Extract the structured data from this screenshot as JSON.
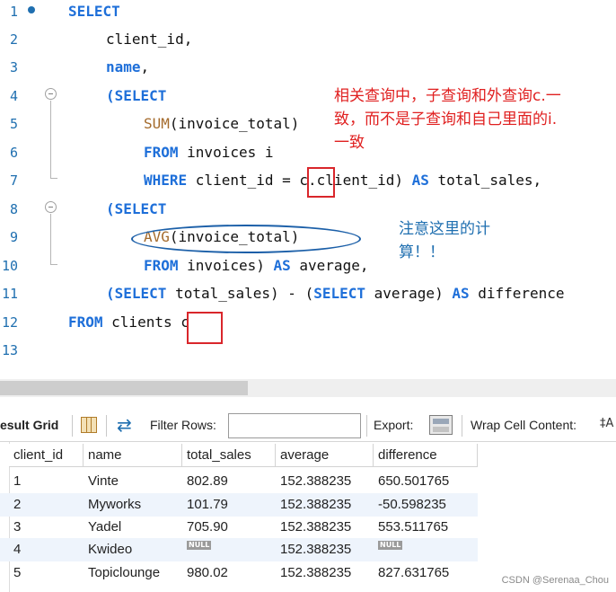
{
  "editor": {
    "line_numbers": [
      "1",
      "2",
      "3",
      "4",
      "5",
      "6",
      "7",
      "8",
      "9",
      "10",
      "11",
      "12",
      "13"
    ],
    "code": {
      "l1_kw": "SELECT",
      "l2": "client_id,",
      "l3_kw": "name",
      "l3_tail": ",",
      "l4_open": "(",
      "l4_kw": "SELECT",
      "l5_fn": "SUM",
      "l5_tail": "(invoice_total)",
      "l6_kw": "FROM",
      "l6_tail": " invoices i",
      "l7_kw": "WHERE",
      "l7_tail": " client_id = c.client_id) ",
      "l7_as": "AS",
      "l7_alias": " total_sales,",
      "l8_open": "(",
      "l8_kw": "SELECT",
      "l9_fn": "AVG",
      "l9_tail": "(invoice_total)",
      "l10_kw": "FROM",
      "l10_tail": " invoices) ",
      "l10_as": "AS",
      "l10_alias": " average,",
      "l11_a": "(",
      "l11_kw1": "SELECT",
      "l11_b": " total_sales) - (",
      "l11_kw2": "SELECT",
      "l11_c": " average) ",
      "l11_as": "AS",
      "l11_d": " difference",
      "l12_kw": "FROM",
      "l12_tail": " clients c"
    },
    "annotation_red": [
      "相关查询中，子查询和外查询c.一",
      "致，而不是子查询和自己里面的i.",
      "一致"
    ],
    "annotation_blue": [
      "注意这里的计",
      "算！！"
    ]
  },
  "toolbar": {
    "result_grid_label": "esult Grid",
    "filter_rows_label": "Filter Rows:",
    "filter_rows_value": "",
    "export_label": "Export:",
    "wrap_label": "Wrap Cell Content:",
    "wrap_icon": "‡A"
  },
  "grid": {
    "columns": [
      "client_id",
      "name",
      "total_sales",
      "average",
      "difference"
    ],
    "rows": [
      [
        "1",
        "Vinte",
        "802.89",
        "152.388235",
        "650.501765"
      ],
      [
        "2",
        "Myworks",
        "101.79",
        "152.388235",
        "-50.598235"
      ],
      [
        "3",
        "Yadel",
        "705.90",
        "152.388235",
        "553.511765"
      ],
      [
        "4",
        "Kwideo",
        "NULL",
        "152.388235",
        "NULL"
      ],
      [
        "5",
        "Topiclounge",
        "980.02",
        "152.388235",
        "827.631765"
      ]
    ]
  },
  "watermark": "CSDN @Serenaa_Chou",
  "colors": {
    "keyword": "#1e6fd9",
    "function": "#a46a2b",
    "red_annotation": "#e02020",
    "blue_annotation": "#1f6fb0",
    "alt_row": "#eef4fc"
  }
}
